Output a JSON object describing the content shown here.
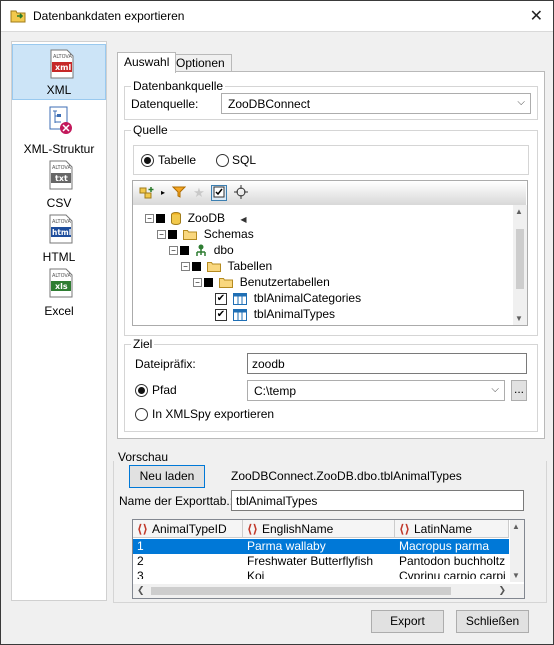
{
  "window": {
    "title": "Datenbankdaten exportieren",
    "close_glyph": "✕"
  },
  "formats": [
    {
      "label": "XML",
      "icon": "xml-file-icon",
      "tag": "xml",
      "selected": true
    },
    {
      "label": "XML-Struktur",
      "icon": "xml-structure-icon",
      "tag": "",
      "selected": false
    },
    {
      "label": "CSV",
      "icon": "txt-file-icon",
      "tag": "txt",
      "selected": false
    },
    {
      "label": "HTML",
      "icon": "html-file-icon",
      "tag": "html",
      "selected": false
    },
    {
      "label": "Excel",
      "icon": "xls-file-icon",
      "tag": "xls",
      "selected": false
    }
  ],
  "tabs": [
    {
      "label": "Auswahl",
      "active": true
    },
    {
      "label": "Optionen",
      "active": false
    }
  ],
  "source_group": {
    "title": "Datenbankquelle",
    "datasource_label": "Datenquelle:",
    "datasource_value": "ZooDBConnect"
  },
  "quelle": {
    "title": "Quelle",
    "radio_table": "Tabelle",
    "radio_sql": "SQL",
    "selected": "Tabelle"
  },
  "tree": {
    "rows": [
      {
        "label": "ZooDB",
        "icon": "database-icon"
      },
      {
        "label": "Schemas",
        "icon": "folder-icon"
      },
      {
        "label": "dbo",
        "icon": "schema-icon"
      },
      {
        "label": "Tabellen",
        "icon": "folder-icon"
      },
      {
        "label": "Benutzertabellen",
        "icon": "folder-icon"
      },
      {
        "label": "tblAnimalCategories",
        "icon": "table-icon",
        "checked": true
      },
      {
        "label": "tblAnimalTypes",
        "icon": "table-icon",
        "checked": true
      }
    ]
  },
  "ziel": {
    "title": "Ziel",
    "prefix_label": "Dateipräfix:",
    "prefix_value": "zoodb",
    "path_label": "Pfad",
    "path_value": "C:\\temp",
    "browse_label": "...",
    "xmlspy_label": "In XMLSpy exportieren",
    "selected": "Pfad"
  },
  "vorschau": {
    "title": "Vorschau",
    "reload_label": "Neu laden",
    "source_path": "ZooDBConnect.ZooDB.dbo.tblAnimalTypes",
    "export_table_label": "Name der Exporttab.:",
    "export_table_value": "tblAnimalTypes",
    "columns": [
      "AnimalTypeID",
      "EnglishName",
      "LatinName"
    ],
    "rows": [
      [
        "1",
        "Parma wallaby",
        "Macropus parma"
      ],
      [
        "2",
        "Freshwater Butterflyfish",
        "Pantodon buchholtz"
      ],
      [
        "3",
        "Koi",
        "Cyprinu carpio carpi"
      ]
    ]
  },
  "buttons": {
    "export": "Export",
    "close": "Schließen"
  }
}
